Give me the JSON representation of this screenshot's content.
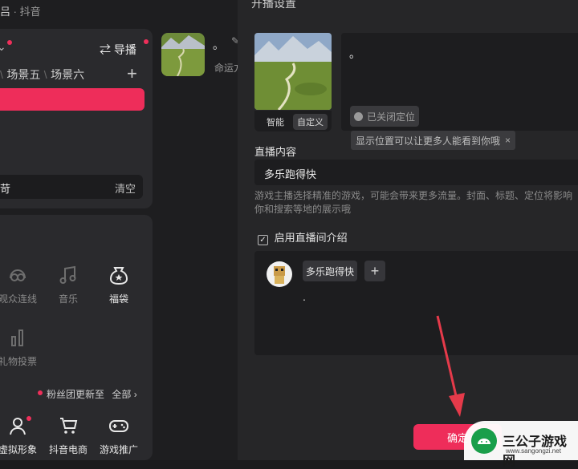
{
  "app": {
    "title_char": "吕",
    "title_sub": "· 抖音"
  },
  "left_panel": {
    "guide_label": "导播",
    "scenes": [
      "场景五",
      "场景六"
    ],
    "add_symbol": "+",
    "search_placeholder_fragment": "苛",
    "clear_label": "清空",
    "tools_row1": [
      {
        "label": "观众连线",
        "icon": "link-icon"
      },
      {
        "label": "音乐",
        "icon": "music-note-icon"
      },
      {
        "label": "福袋",
        "icon": "lucky-bag-icon"
      }
    ],
    "tools_row2": [
      {
        "label": "礼物投票",
        "icon": "bar-chart-icon"
      }
    ],
    "fan_update_text": "粉丝团更新至",
    "all_label": "全部",
    "tools_bottom": [
      {
        "label": "虚拟形象",
        "icon": "avatar-icon"
      },
      {
        "label": "抖音电商",
        "icon": "cart-icon"
      },
      {
        "label": "游戏推广",
        "icon": "gamepad-icon"
      }
    ]
  },
  "preview": {
    "dot_text": "。",
    "caption_fragment": "命运方"
  },
  "dialog": {
    "title": "开播设置",
    "cover_buttons": [
      "智能",
      "自定义"
    ],
    "title_text": "。",
    "location_button": "已关闭定位",
    "location_tip": "显示位置可以让更多人能看到你哦",
    "live_content_label": "直播内容",
    "game_name": "多乐跑得快",
    "description": "游戏主播选择精准的游戏，可能会带来更多流量。封面、标题、定位将影响你和搜索等地的展示哦",
    "intro_checkbox_label": "启用直播间介绍",
    "intro_tag": "多乐跑得快",
    "intro_add": "+",
    "intro_text": ".",
    "confirm_label": "确定"
  },
  "watermark": {
    "cn": "三公子游戏网",
    "url": "www.sangongzi.net"
  },
  "colors": {
    "accent": "#ee2d5a",
    "dialog_bg": "#262628",
    "input_bg": "#1d1d1f"
  }
}
